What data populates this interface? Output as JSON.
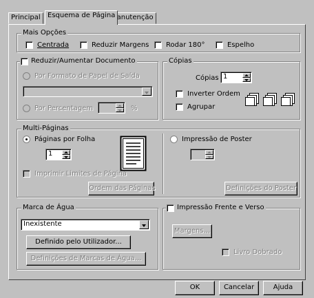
{
  "tabs": [
    {
      "label": "Principal"
    },
    {
      "label": "Esquema de Página"
    },
    {
      "label": "Manutenção"
    }
  ],
  "mais_opcoes": {
    "title": "Mais Opções",
    "centrada": "Centrada",
    "reduzir_margens": "Reduzir Margens",
    "rodar": "Rodar 180°",
    "espelho": "Espelho"
  },
  "reduzir": {
    "title": "Reduzir/Aumentar Documento",
    "por_formato": "Por Formato de Papel de Saída",
    "por_percentagem": "Por Percentagem",
    "percent_sign": "%"
  },
  "copias": {
    "title": "Cópias",
    "label": "Cópias",
    "value": "1",
    "inverter": "Inverter Ordem",
    "agrupar": "Agrupar"
  },
  "multi": {
    "title": "Multi-Páginas",
    "paginas_por_folha": "Páginas por Folha",
    "paginas_value": "1",
    "imprimir_limites": "Imprimir Limites de Página",
    "ordem": "Ordem das Páginas",
    "poster": "Impressão de Poster",
    "definicoes_poster": "Definições do Poster"
  },
  "marca": {
    "title": "Marca de Água",
    "selected": "Inexistente",
    "definido": "Definido pelo Utilizador...",
    "definicoes": "Definições de Marcas de Água..."
  },
  "duplex": {
    "title": "Impressão Frente e Verso",
    "margens": "Margens...",
    "livro": "Livro Dobrado"
  },
  "buttons": {
    "ok": "OK",
    "cancelar": "Cancelar",
    "ajuda": "Ajuda"
  }
}
